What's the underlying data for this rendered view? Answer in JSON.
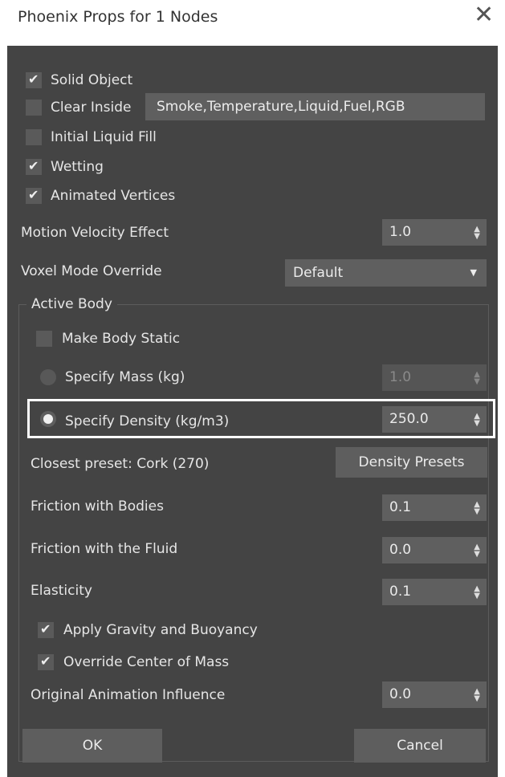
{
  "window": {
    "title": "Phoenix Props for 1 Nodes",
    "close_glyph": "✕"
  },
  "props": {
    "solid_object": {
      "label": "Solid Object",
      "checked": true
    },
    "clear_inside": {
      "label": "Clear Inside",
      "checked": false,
      "channels": "Smoke,Temperature,Liquid,Fuel,RGB"
    },
    "initial_liquid_fill": {
      "label": "Initial Liquid Fill",
      "checked": false
    },
    "wetting": {
      "label": "Wetting",
      "checked": true
    },
    "animated_vertices": {
      "label": "Animated Vertices",
      "checked": true
    },
    "motion_velocity_effect": {
      "label": "Motion Velocity Effect",
      "value": "1.0"
    },
    "voxel_mode_override": {
      "label": "Voxel Mode Override",
      "value": "Default"
    }
  },
  "active_body": {
    "group_title": "Active Body",
    "make_body_static": {
      "label": "Make Body Static",
      "checked": false
    },
    "specify_mass": {
      "label": "Specify Mass (kg)",
      "value": "1.0",
      "selected": false
    },
    "specify_density": {
      "label": "Specify Density (kg/m3)",
      "value": "250.0",
      "selected": true
    },
    "closest_preset": "Closest preset: Cork (270)",
    "density_presets_button": "Density Presets",
    "friction_bodies": {
      "label": "Friction with Bodies",
      "value": "0.1"
    },
    "friction_fluid": {
      "label": "Friction with the Fluid",
      "value": "0.0"
    },
    "elasticity": {
      "label": "Elasticity",
      "value": "0.1"
    },
    "apply_gravity": {
      "label": "Apply Gravity and Buoyancy",
      "checked": true
    },
    "override_com": {
      "label": "Override Center of Mass",
      "checked": true
    },
    "original_anim_influence": {
      "label": "Original Animation Influence",
      "value": "0.0"
    }
  },
  "buttons": {
    "ok": "OK",
    "cancel": "Cancel"
  },
  "icons": {
    "spinner": "▲▼",
    "dropdown": "▼"
  },
  "colors": {
    "dialog_bg": "#444444",
    "control_bg": "#5f5f5f",
    "highlight": "#ffffff"
  }
}
